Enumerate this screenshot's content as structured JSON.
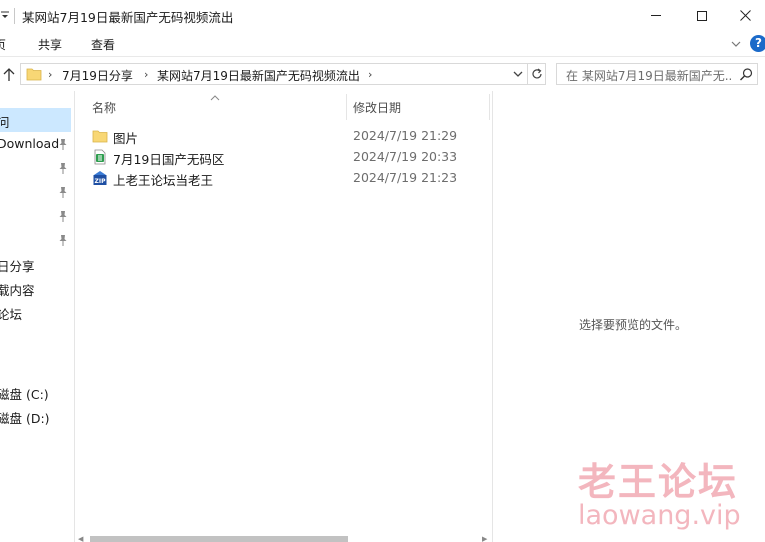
{
  "window": {
    "title": "某网站7月19日最新国产无码视频流出"
  },
  "ribbon": {
    "tabs": [
      "页",
      "共享",
      "查看"
    ]
  },
  "address": {
    "crumbs": [
      "7月19日分享",
      "某网站7月19日最新国产无码视频流出"
    ],
    "search_placeholder": "在 某网站7月19日最新国产无..."
  },
  "nav": {
    "items": [
      {
        "label": "问",
        "selected": true,
        "pinned": false
      },
      {
        "label": "Download",
        "selected": false,
        "pinned": true
      },
      {
        "label": "",
        "selected": false,
        "pinned": true
      },
      {
        "label": "",
        "selected": false,
        "pinned": true
      },
      {
        "label": "",
        "selected": false,
        "pinned": true
      },
      {
        "label": "",
        "selected": false,
        "pinned": true
      },
      {
        "label": "日分享",
        "selected": false,
        "pinned": false
      },
      {
        "label": "载内容",
        "selected": false,
        "pinned": false
      },
      {
        "label": "论坛",
        "selected": false,
        "pinned": false
      },
      {
        "label": "磁盘 (C:)",
        "selected": false,
        "pinned": false
      },
      {
        "label": "磁盘 (D:)",
        "selected": false,
        "pinned": false
      }
    ]
  },
  "columns": {
    "name": "名称",
    "modified": "修改日期"
  },
  "files": [
    {
      "name": "图片",
      "date": "2024/7/19 21:29",
      "icon": "folder-icon"
    },
    {
      "name": "7月19日国产无码区",
      "date": "2024/7/19 20:33",
      "icon": "spreadsheet-file-icon"
    },
    {
      "name": "上老王论坛当老王",
      "date": "2024/7/19 21:23",
      "icon": "zip-file-icon"
    }
  ],
  "preview": {
    "empty_text": "选择要预览的文件。"
  },
  "watermark": {
    "cn": "老王论坛",
    "en": "laowang.vip"
  },
  "colors": {
    "selection": "#cce8ff",
    "folder": "#f8d775",
    "help": "#1b6ac9",
    "watermark": "#f3b6be"
  }
}
